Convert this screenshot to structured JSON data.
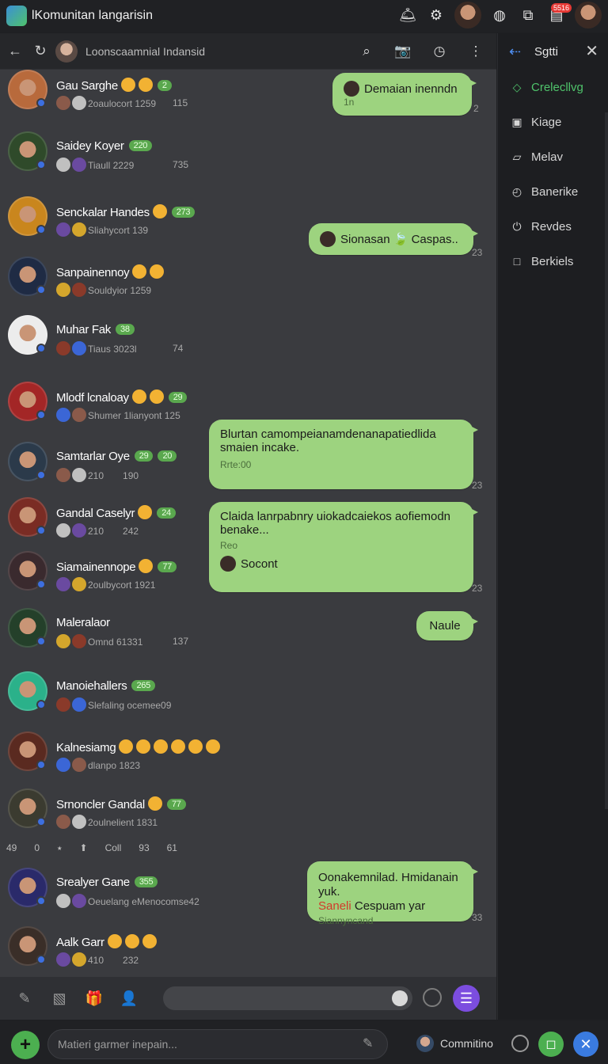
{
  "window": {
    "title": "lKomunitan langarisin",
    "badge": "5516"
  },
  "chat_header": {
    "title": "Loonscaamnial Indansid"
  },
  "members": [
    {
      "name": "Gau Sarghe",
      "tag": "2",
      "sub": "2oaulocort 1259",
      "count": "115",
      "avatar_color": "#b86a3c",
      "emoji": 2
    },
    {
      "name": "Saidey Koyer",
      "tag": "220",
      "sub": "Tiaull 2229",
      "count": "735",
      "avatar_color": "#2f4a2a",
      "emoji": 0
    },
    {
      "name": "Senckalar Handes",
      "tag": "273",
      "sub": "Sliahycort 139",
      "count": "",
      "avatar_color": "#c9861e",
      "emoji": 1
    },
    {
      "name": "Sanpainennoy",
      "tag": "",
      "sub": "Souldyior 1259",
      "count": "",
      "avatar_color": "#1f2b44",
      "emoji": 2
    },
    {
      "name": "Muhar Fak",
      "tag": "38",
      "sub": "Tiaus 3023l",
      "count": "74",
      "avatar_color": "#ececec",
      "emoji": 0
    },
    {
      "name": "Mlodf lcnaloay",
      "tag": "29",
      "sub": "Shumer 1lianyont 125",
      "count": "",
      "avatar_color": "#a32626",
      "emoji": 2
    },
    {
      "name": "Samtarlar Oye",
      "tag": "29",
      "tag2": "20",
      "sub": "210",
      "sub2": "190",
      "count": "",
      "avatar_color": "#2b3a4a",
      "emoji": 0
    },
    {
      "name": "Gandal Caselyr",
      "tag": "24",
      "sub": "210",
      "sub2": "242",
      "count": "",
      "avatar_color": "#7a2c24",
      "emoji": 1
    },
    {
      "name": "Siamainennope",
      "tag": "77",
      "sub": "2oulbycort 1921",
      "count": "",
      "avatar_color": "#3a2a2e",
      "emoji": 1
    },
    {
      "name": "Maleralaor",
      "tag": "",
      "sub": "Omnd 61331",
      "count": "137",
      "avatar_color": "#24402a",
      "emoji": 0
    },
    {
      "name": "Manoiehallers",
      "tag": "265",
      "sub": "Slefaling ocemee09",
      "count": "",
      "avatar_color": "#2bb18a",
      "emoji": 0
    },
    {
      "name": "Kalnesiamg",
      "tag": "",
      "sub": "dlanpo 1823",
      "count": "",
      "avatar_color": "#5a2a20",
      "emoji": 6
    },
    {
      "name": "Srnoncler Gandal",
      "tag": "77",
      "sub": "2oulnelient 1831",
      "count": "",
      "avatar_color": "#3b3b30",
      "emoji": 1
    },
    {
      "name": "Srealyer Gane",
      "tag": "355",
      "sub": "Oeuelang eMenocomse42",
      "count": "",
      "avatar_color": "#2a2a6a",
      "emoji": 0
    },
    {
      "name": "Aalk Garr",
      "tag": "",
      "sub": "410",
      "sub2": "232",
      "count": "",
      "avatar_color": "#3a2e28",
      "emoji": 3
    }
  ],
  "messages": [
    {
      "text": "Demaian inenndn",
      "meta": "1n",
      "time": "2"
    },
    {
      "text": "Sionasan",
      "text2": "Caspas..",
      "time": "23"
    },
    {
      "text": "Blurtan camompeianamdenanapatiedlida smaien incake.",
      "meta": "Rrte:00",
      "time": "23"
    },
    {
      "text": "Claida lanrpabnry uiokadcaiekos aofiemodn benake...",
      "meta": "Reo",
      "sender": "Socont",
      "time": "23"
    },
    {
      "text": "Naule"
    },
    {
      "text": "Oonakemnilad. Hmidanain yuk.",
      "highlight": "Saneli",
      "text2": "Cespuam yar",
      "meta": "Siannyncand",
      "time": "33"
    }
  ],
  "status_row": {
    "a": "49",
    "b": "0",
    "c": "Coll",
    "d": "93",
    "e": "61"
  },
  "sidebar": {
    "title": "Sgtti",
    "items": [
      {
        "label": "Crelecllvg",
        "active": true
      },
      {
        "label": "Kiage"
      },
      {
        "label": "Melav"
      },
      {
        "label": "Banerike"
      },
      {
        "label": "Revdes"
      },
      {
        "label": "Berkiels"
      }
    ]
  },
  "bottom": {
    "placeholder": "Matieri garmer inepain...",
    "user_label": "Commitino"
  },
  "colors": {
    "bubble": "#9dd37f",
    "accent_green": "#4caf50",
    "accent_blue": "#3a7be0",
    "accent_purple": "#7c4ddf"
  }
}
